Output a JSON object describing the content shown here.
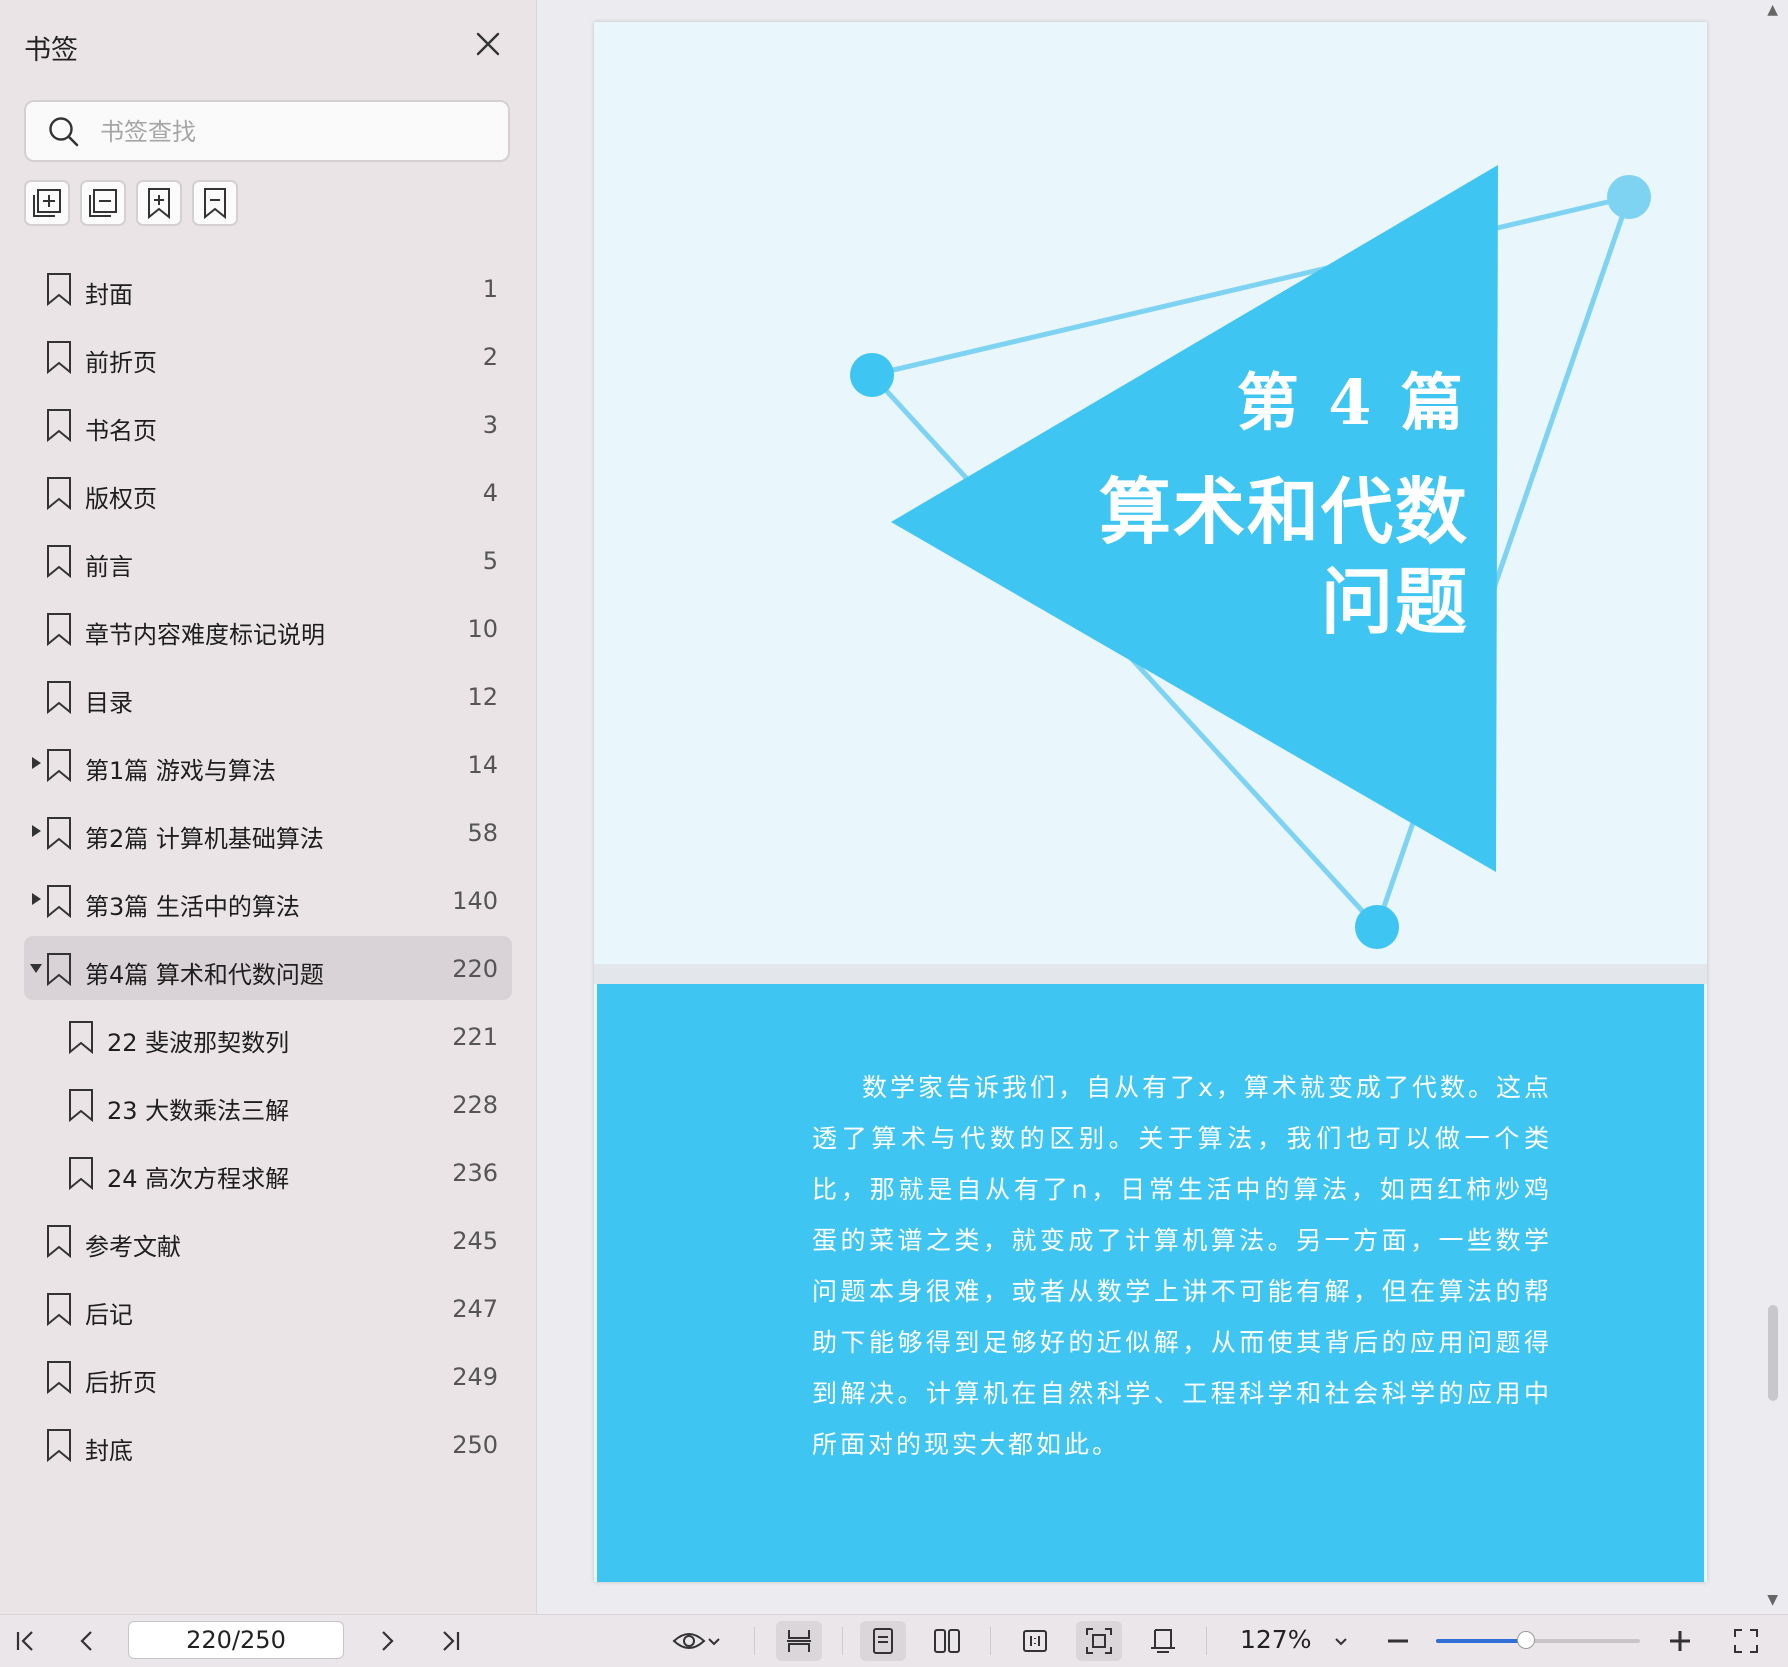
{
  "sidebar": {
    "title": "书签",
    "search_placeholder": "书签查找",
    "bookmarks": [
      {
        "label": "封面",
        "page": "1",
        "level": 0,
        "expand": "none",
        "selected": false
      },
      {
        "label": "前折页",
        "page": "2",
        "level": 0,
        "expand": "none",
        "selected": false
      },
      {
        "label": "书名页",
        "page": "3",
        "level": 0,
        "expand": "none",
        "selected": false
      },
      {
        "label": "版权页",
        "page": "4",
        "level": 0,
        "expand": "none",
        "selected": false
      },
      {
        "label": "前言",
        "page": "5",
        "level": 0,
        "expand": "none",
        "selected": false
      },
      {
        "label": "章节内容难度标记说明",
        "page": "10",
        "level": 0,
        "expand": "none",
        "selected": false
      },
      {
        "label": "目录",
        "page": "12",
        "level": 0,
        "expand": "none",
        "selected": false
      },
      {
        "label": "第1篇  游戏与算法",
        "page": "14",
        "level": 0,
        "expand": "collapsed",
        "selected": false
      },
      {
        "label": "第2篇  计算机基础算法",
        "page": "58",
        "level": 0,
        "expand": "collapsed",
        "selected": false
      },
      {
        "label": "第3篇  生活中的算法",
        "page": "140",
        "level": 0,
        "expand": "collapsed",
        "selected": false
      },
      {
        "label": "第4篇  算术和代数问题",
        "page": "220",
        "level": 0,
        "expand": "expanded",
        "selected": true
      },
      {
        "label": "22  斐波那契数列",
        "page": "221",
        "level": 1,
        "expand": "none",
        "selected": false
      },
      {
        "label": "23  大数乘法三解",
        "page": "228",
        "level": 1,
        "expand": "none",
        "selected": false
      },
      {
        "label": "24  高次方程求解",
        "page": "236",
        "level": 1,
        "expand": "none",
        "selected": false
      },
      {
        "label": "参考文献",
        "page": "245",
        "level": 0,
        "expand": "none",
        "selected": false
      },
      {
        "label": "后记",
        "page": "247",
        "level": 0,
        "expand": "none",
        "selected": false
      },
      {
        "label": "后折页",
        "page": "249",
        "level": 0,
        "expand": "none",
        "selected": false
      },
      {
        "label": "封底",
        "page": "250",
        "level": 0,
        "expand": "none",
        "selected": false
      }
    ]
  },
  "page_content": {
    "part": "第 4 篇",
    "title_line1": "算术和代数",
    "title_line2": "问题",
    "body": "数学家告诉我们，自从有了x，算术就变成了代数。这点透了算术与代数的区别。关于算法，我们也可以做一个类比，那就是自从有了n，日常生活中的算法，如西红柿炒鸡蛋的菜谱之类，就变成了计算机算法。另一方面，一些数学问题本身很难，或者从数学上讲不可能有解，但在算法的帮助下能够得到足够好的近似解，从而使其背后的应用问题得到解决。计算机在自然科学、工程科学和社会科学的应用中所面对的现实大都如此。",
    "colors": {
      "triangle": "#3fc5f1",
      "lines": "#7fd3f2",
      "dots": "#3fc5f1",
      "background": "#e9f6fc",
      "band": "#3fc5f1"
    }
  },
  "toolbar": {
    "page_indicator": "220/250",
    "zoom": "127%",
    "zoom_slider_fraction": 0.44
  }
}
